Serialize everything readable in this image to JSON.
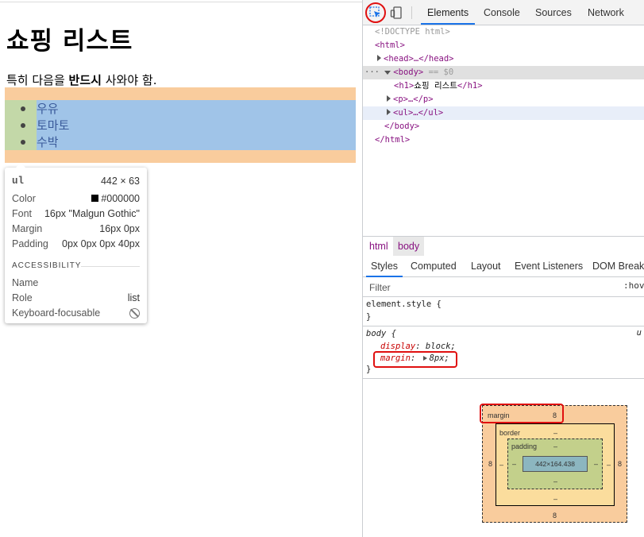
{
  "preview": {
    "heading": "쇼핑 리스트",
    "paragraph_prefix": "특히 다음을 ",
    "paragraph_bold": "반드시",
    "paragraph_suffix": " 사와야 함.",
    "list_items": [
      "우유",
      "토마토",
      "수박"
    ]
  },
  "tooltip": {
    "tag": "ul",
    "size": "442 × 63",
    "color_label": "Color",
    "color_value": "#000000",
    "font_label": "Font",
    "font_value": "16px \"Malgun Gothic\"",
    "margin_label": "Margin",
    "margin_value": "16px 0px",
    "padding_label": "Padding",
    "padding_value": "0px 0px 0px 40px",
    "accessibility_heading": "ACCESSIBILITY",
    "name_label": "Name",
    "name_value": "",
    "role_label": "Role",
    "role_value": "list",
    "keyboard_label": "Keyboard-focusable"
  },
  "devtools": {
    "tabs": [
      "Elements",
      "Console",
      "Sources",
      "Network"
    ],
    "active_tab": "Elements",
    "tree": {
      "doctype": "<!DOCTYPE html>",
      "html_open": "<html>",
      "head": "<head>…</head>",
      "body_open": "<body>",
      "body_marker": "== $0",
      "dots": "···",
      "h1_open": "<h1>",
      "h1_text": "쇼핑 리스트",
      "h1_close": "</h1>",
      "p": "<p>…</p>",
      "ul": "<ul>…</ul>",
      "body_close": "</body>",
      "html_close": "</html>"
    },
    "breadcrumbs": [
      "html",
      "body"
    ],
    "subtabs": [
      "Styles",
      "Computed",
      "Layout",
      "Event Listeners",
      "DOM Break"
    ],
    "filter_placeholder": "Filter",
    "hov_label": ":hov",
    "element_style_open": "element.style {",
    "element_style_close": "}",
    "body_rule": {
      "selector": "body {",
      "origin": "u",
      "prop1": "display",
      "val1": "block;",
      "prop2": "margin",
      "val2": "8px;",
      "close": "}"
    },
    "box_model": {
      "margin_label": "margin",
      "margin_top": "8",
      "margin_right": "8",
      "margin_bottom": "8",
      "margin_left": "8",
      "border_label": "border",
      "border_top": "–",
      "border_right": "–",
      "border_bottom": "–",
      "border_left": "–",
      "padding_label": "padding",
      "padding_top": "–",
      "padding_right": "–",
      "padding_bottom": "–",
      "padding_left": "–",
      "content": "442×164.438"
    }
  },
  "colors": {
    "margin_highlight": "#f9cc9d",
    "padding_highlight": "#c3d8a8",
    "content_highlight": "#a0c4e8",
    "accent": "#1a73e8",
    "annotation": "#e01010",
    "tag_color": "#881280"
  }
}
